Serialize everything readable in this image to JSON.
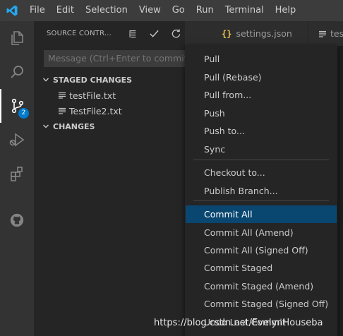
{
  "menubar": {
    "items": [
      "File",
      "Edit",
      "Selection",
      "View",
      "Go",
      "Run",
      "Terminal",
      "Help"
    ]
  },
  "activitybar": {
    "items": [
      {
        "icon": "files-icon"
      },
      {
        "icon": "search-icon"
      },
      {
        "icon": "source-control-icon",
        "badge": "2"
      },
      {
        "icon": "run-debug-icon"
      },
      {
        "icon": "extensions-icon"
      },
      {
        "icon": "github-icon"
      }
    ]
  },
  "sidebar": {
    "title": "SOURCE CONTR...",
    "actions": [
      "view-as-tree-icon",
      "commit-check-icon",
      "refresh-icon",
      "more-actions-icon"
    ],
    "message_placeholder": "Message (Ctrl+Enter to commit on",
    "staged": {
      "label": "STAGED CHANGES",
      "files": [
        "testFile.txt",
        "TestFile2.txt"
      ]
    },
    "changes": {
      "label": "CHANGES"
    }
  },
  "tabs": [
    {
      "label": "settings.json",
      "icon": "json-braces-icon"
    },
    {
      "label": "test",
      "icon": "text-file-icon"
    }
  ],
  "context_menu": {
    "groups": [
      [
        "Pull",
        "Pull (Rebase)",
        "Pull from...",
        "Push",
        "Push to...",
        "Sync"
      ],
      [
        "Checkout to...",
        "Publish Branch..."
      ],
      [
        "Commit All",
        "Commit All (Amend)",
        "Commit All (Signed Off)",
        "Commit Staged",
        "Commit Staged (Amend)",
        "Commit Staged (Signed Off)",
        "Undo Last Commit"
      ]
    ],
    "highlighted": "Commit All"
  },
  "watermark": "https://blog.csdn.net/EvelynHouseba",
  "colors": {
    "accent": "#007acc",
    "highlight": "#094771",
    "logo": "#23a9f2"
  }
}
